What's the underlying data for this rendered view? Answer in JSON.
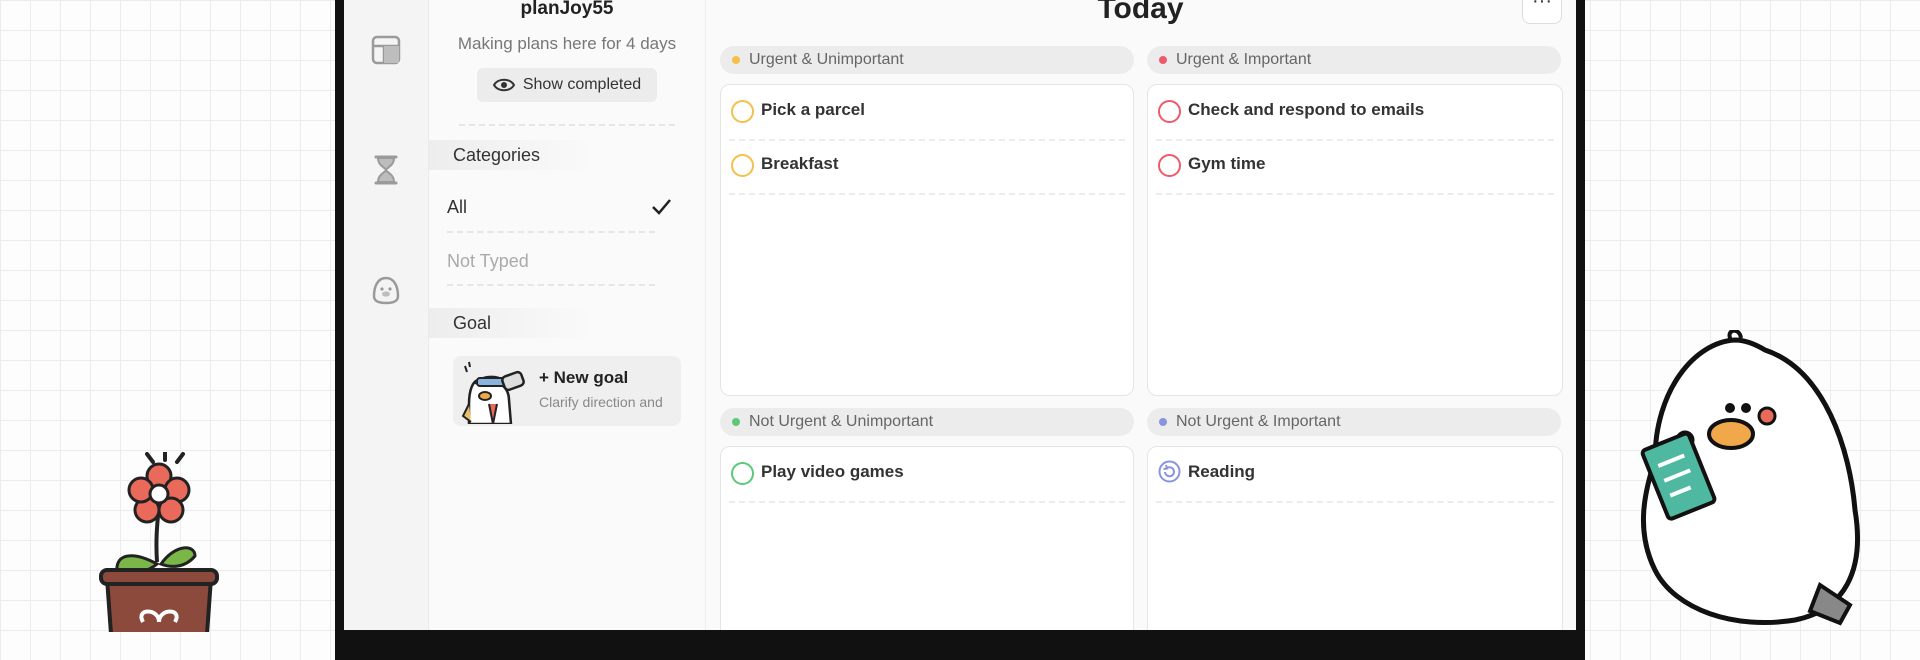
{
  "sidebar": {
    "user_name": "planJoy55",
    "subtitle": "Making plans here for 4 days",
    "show_completed": "Show completed",
    "categories_label": "Categories",
    "categories": [
      {
        "label": "All",
        "selected": true
      },
      {
        "label": "Not Typed",
        "selected": false
      }
    ],
    "goal_label": "Goal",
    "new_goal_title": "+ New goal",
    "new_goal_sub": "Clarify direction and"
  },
  "rail": {
    "icons": [
      "layout-icon",
      "hourglass-icon",
      "mascot-icon"
    ]
  },
  "main": {
    "title": "Today",
    "more": "···",
    "quadrants": [
      {
        "label": "Urgent & Unimportant",
        "color": "#f5c04a",
        "tasks": [
          "Pick a parcel",
          "Breakfast"
        ]
      },
      {
        "label": "Urgent & Important",
        "color": "#ef5a6a",
        "tasks": [
          "Check and respond to emails",
          "Gym time"
        ]
      },
      {
        "label": "Not Urgent & Unimportant",
        "color": "#5cc87a",
        "tasks": [
          "Play video games"
        ]
      },
      {
        "label": "Not Urgent & Important",
        "color": "#8a93e0",
        "tasks": [
          "Reading"
        ]
      }
    ]
  }
}
